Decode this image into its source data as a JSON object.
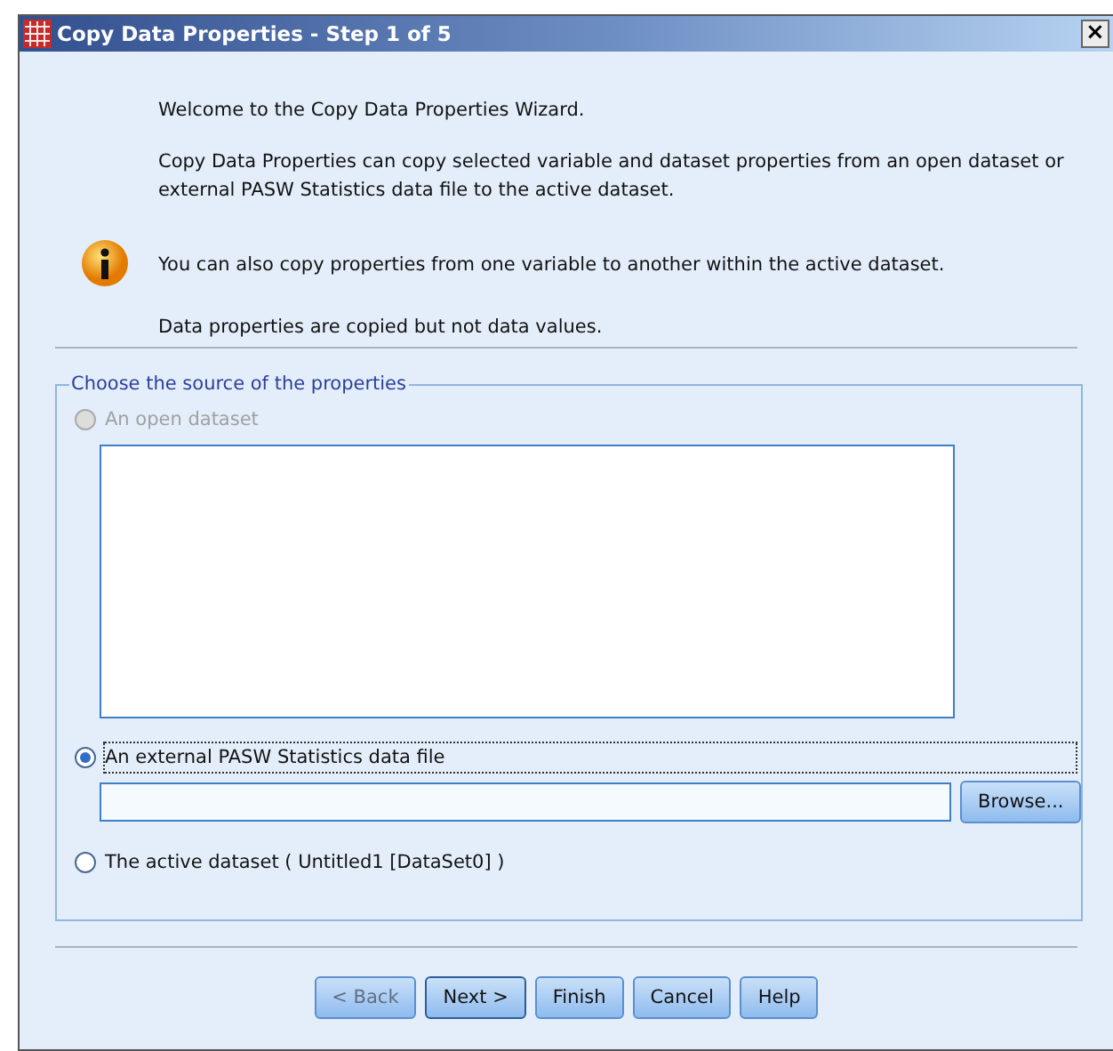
{
  "window": {
    "title": "Copy Data Properties - Step 1 of 5",
    "close": "×"
  },
  "intro": {
    "welcome": "Welcome to the Copy Data Properties Wizard.",
    "description": "Copy Data Properties can copy selected variable and dataset properties from an open dataset or external PASW Statistics data file to the active dataset.",
    "tip": "You can also copy properties from one variable to another within the active dataset.",
    "note": "Data properties are copied but not data values."
  },
  "source": {
    "legend": "Choose the source of the properties",
    "options": [
      {
        "kind": "list",
        "label": "An open dataset",
        "selected": false,
        "disabled": true
      },
      {
        "kind": "file",
        "label": "An external PASW Statistics data file",
        "selected": true,
        "disabled": false,
        "button": "Browse..."
      },
      {
        "kind": "plain",
        "label": "The active dataset ( Untitled1 [DataSet0] )",
        "selected": false,
        "disabled": false
      }
    ]
  },
  "buttons": [
    {
      "label": "< Back",
      "disabled": true,
      "default": false
    },
    {
      "label": "Next >",
      "disabled": false,
      "default": true
    },
    {
      "label": "Finish",
      "disabled": false,
      "default": false
    },
    {
      "label": "Cancel",
      "disabled": false,
      "default": false
    },
    {
      "label": "Help",
      "disabled": false,
      "default": false
    }
  ]
}
